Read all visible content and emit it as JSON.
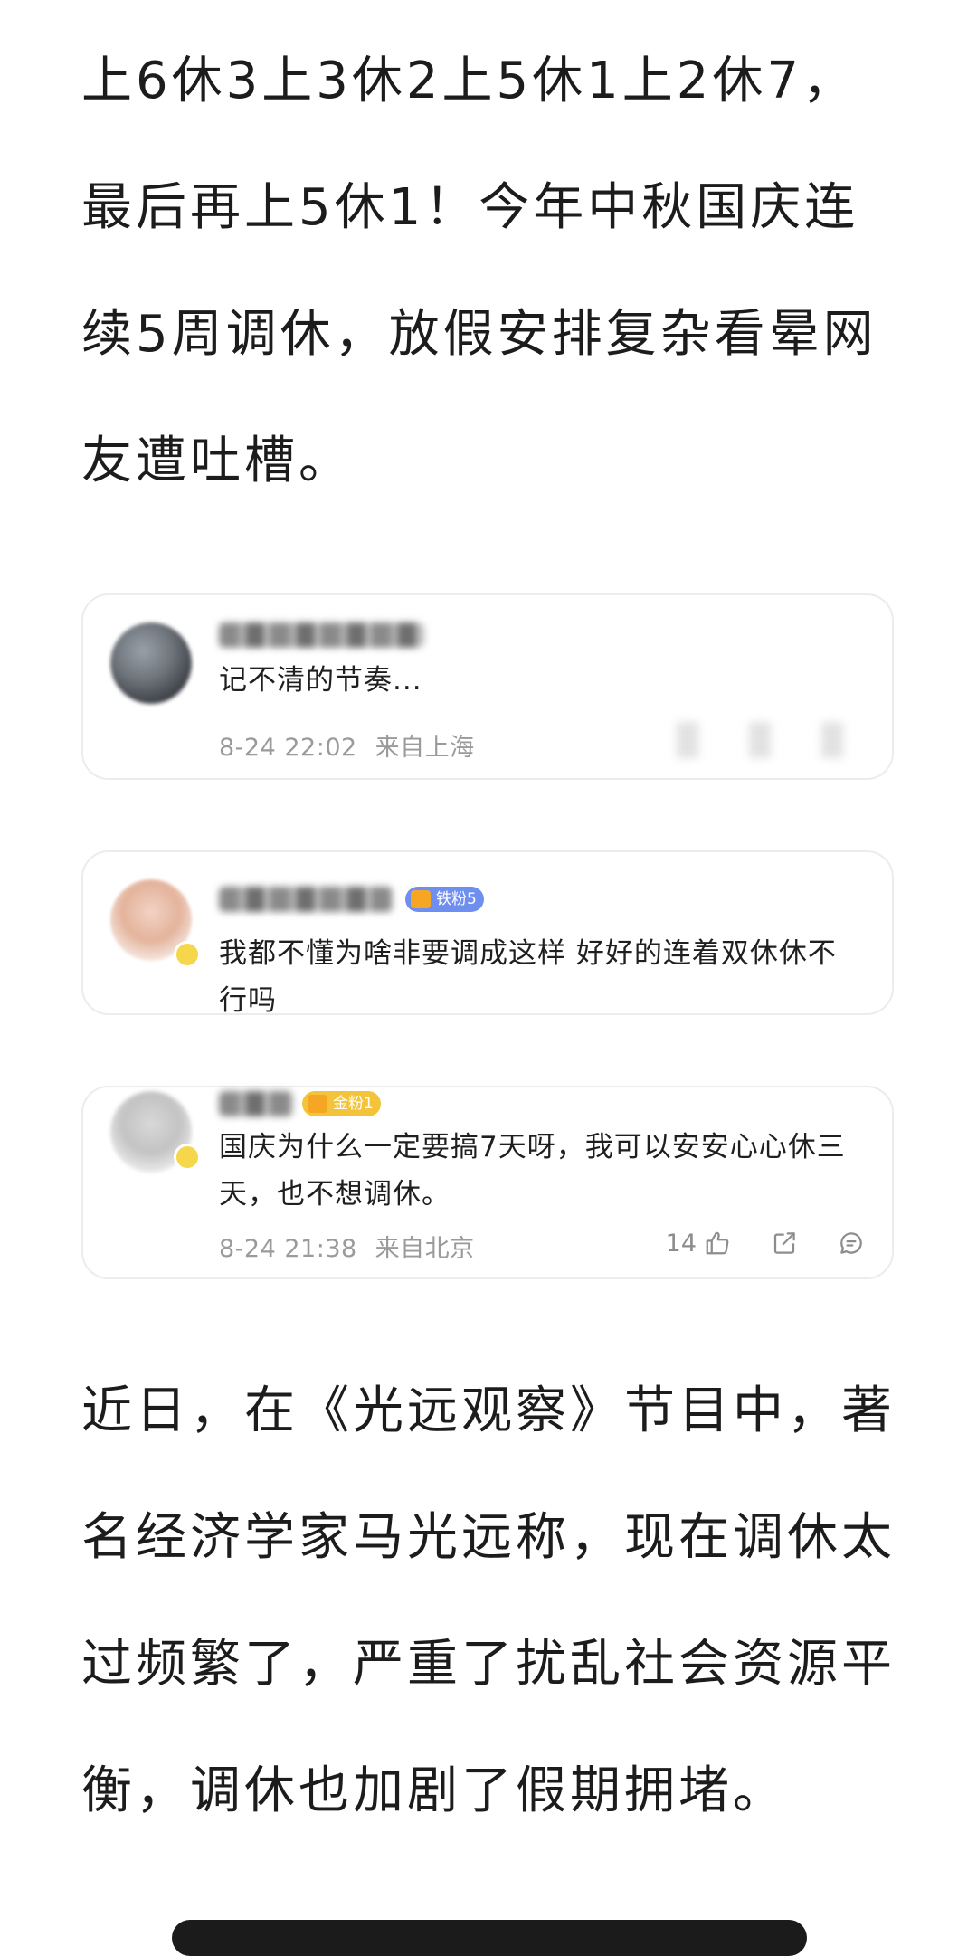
{
  "article": {
    "paragraph_1": "上6休3上3休2上5休1上2休7，最后再上5休1！今年中秋国庆连续5周调休，放假安排复杂看晕网友遭吐槽。",
    "paragraph_2": "近日，在《光远观察》节目中，著名经济学家马光远称，现在调休太过频繁了，严重了扰乱社会资源平衡，调休也加剧了假期拥堵。"
  },
  "comments": [
    {
      "text": "记不清的节奏...",
      "date": "8-24 22:02",
      "location": "来自上海"
    },
    {
      "fan_badge": "铁粉5",
      "text": "我都不懂为啥非要调成这样 好好的连着双休休不行吗"
    },
    {
      "fan_badge": "金粉1",
      "text": "国庆为什么一定要搞7天呀，我可以安安心心休三天，也不想调休。",
      "date": "8-24 21:38",
      "location": "来自北京",
      "like_count": "14"
    }
  ],
  "icons": {
    "like": "thumbs-up-icon",
    "share": "share-icon",
    "reply": "comment-icon"
  },
  "colors": {
    "text_primary": "#1c1c1c",
    "text_meta": "#9a9a9a",
    "card_border": "#ececec",
    "iron_fan_badge": "#6f8ff0",
    "gold_fan_badge": "#f3c43a"
  }
}
